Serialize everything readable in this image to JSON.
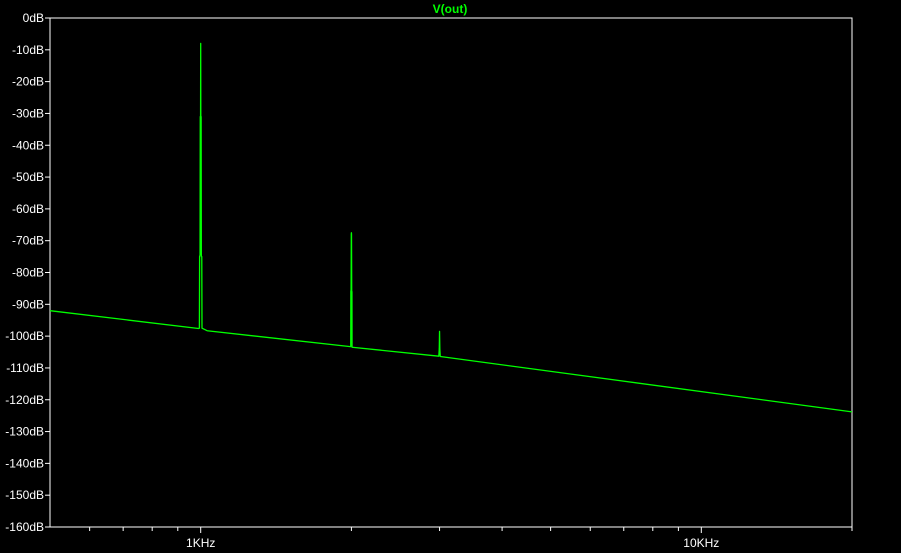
{
  "chart_data": {
    "type": "line",
    "title": "V(out)",
    "xlabel": "",
    "ylabel": "",
    "x_scale": "log",
    "x_unit": "Hz",
    "xlim": [
      500,
      20000
    ],
    "ylim": [
      -160,
      0
    ],
    "y_ticks": [
      0,
      -10,
      -20,
      -30,
      -40,
      -50,
      -60,
      -70,
      -80,
      -90,
      -100,
      -110,
      -120,
      -130,
      -140,
      -150,
      -160
    ],
    "y_tick_labels": [
      "0dB",
      "-10dB",
      "-20dB",
      "-30dB",
      "-40dB",
      "-50dB",
      "-60dB",
      "-70dB",
      "-80dB",
      "-90dB",
      "-100dB",
      "-110dB",
      "-120dB",
      "-130dB",
      "-140dB",
      "-150dB",
      "-160dB"
    ],
    "x_tick_labels": [
      {
        "value": 1000,
        "label": "1KHz"
      },
      {
        "value": 10000,
        "label": "10KHz"
      }
    ],
    "x_minor_ticks": [
      600,
      700,
      800,
      900,
      2000,
      3000,
      4000,
      5000,
      6000,
      7000,
      8000,
      9000,
      20000
    ],
    "grid": false,
    "series": [
      {
        "name": "V(out)",
        "color": "#00ff00",
        "points": [
          {
            "x": 500,
            "y": -92
          },
          {
            "x": 990,
            "y": -97.6
          },
          {
            "x": 994,
            "y": -97.5
          },
          {
            "x": 995,
            "y": -75
          },
          {
            "x": 997,
            "y": -74.5
          },
          {
            "x": 998,
            "y": -31
          },
          {
            "x": 999.4,
            "y": -31
          },
          {
            "x": 1000,
            "y": -8
          },
          {
            "x": 1000.6,
            "y": -31
          },
          {
            "x": 1002,
            "y": -31
          },
          {
            "x": 1003,
            "y": -75
          },
          {
            "x": 1005,
            "y": -75
          },
          {
            "x": 1006,
            "y": -97.5
          },
          {
            "x": 1030,
            "y": -98.3
          },
          {
            "x": 1990,
            "y": -103.3
          },
          {
            "x": 1994,
            "y": -103.3
          },
          {
            "x": 1995,
            "y": -86
          },
          {
            "x": 1997,
            "y": -85.5
          },
          {
            "x": 1999,
            "y": -68
          },
          {
            "x": 2000,
            "y": -67.5
          },
          {
            "x": 2001,
            "y": -68
          },
          {
            "x": 2003,
            "y": -86
          },
          {
            "x": 2005,
            "y": -86
          },
          {
            "x": 2006,
            "y": -103.5
          },
          {
            "x": 2990,
            "y": -106.3
          },
          {
            "x": 2996,
            "y": -104
          },
          {
            "x": 3000,
            "y": -98.5
          },
          {
            "x": 3004,
            "y": -104
          },
          {
            "x": 3010,
            "y": -106.4
          },
          {
            "x": 20000,
            "y": -123.8
          }
        ]
      }
    ]
  }
}
